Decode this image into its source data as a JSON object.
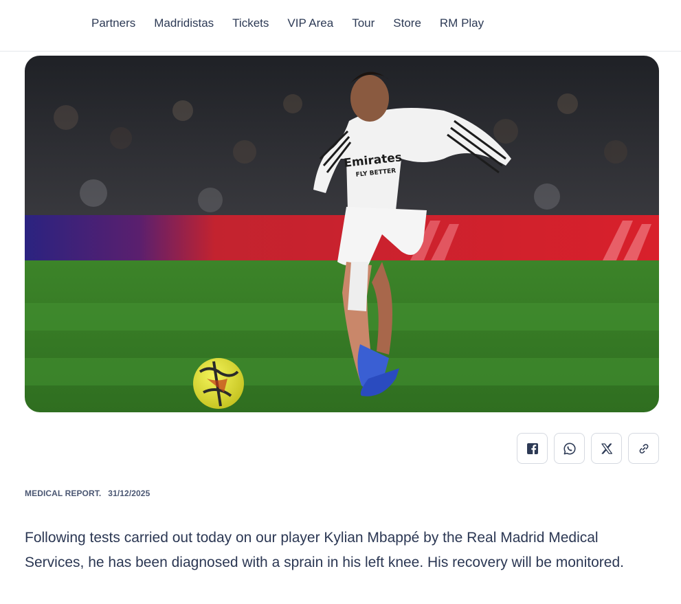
{
  "nav": {
    "items": [
      "Partners",
      "Madridistas",
      "Tickets",
      "VIP Area",
      "Tour",
      "Store",
      "RM Play"
    ]
  },
  "hero": {
    "jersey_sponsor": "Emirates",
    "jersey_slogan": "FLY BETTER",
    "colors": {
      "pitch": "#3f8a2a",
      "board": "#d8202b",
      "crowd": "#2a2a2e"
    }
  },
  "share": {
    "icons": [
      "facebook-icon",
      "whatsapp-icon",
      "x-icon",
      "link-icon"
    ]
  },
  "article": {
    "category": "MEDICAL REPORT.",
    "date": "31/12/2025",
    "body": "Following tests carried out today on our player Kylian Mbappé by the Real Madrid Medical Services, he has been diagnosed with a sprain in his left knee. His recovery will be monitored."
  }
}
